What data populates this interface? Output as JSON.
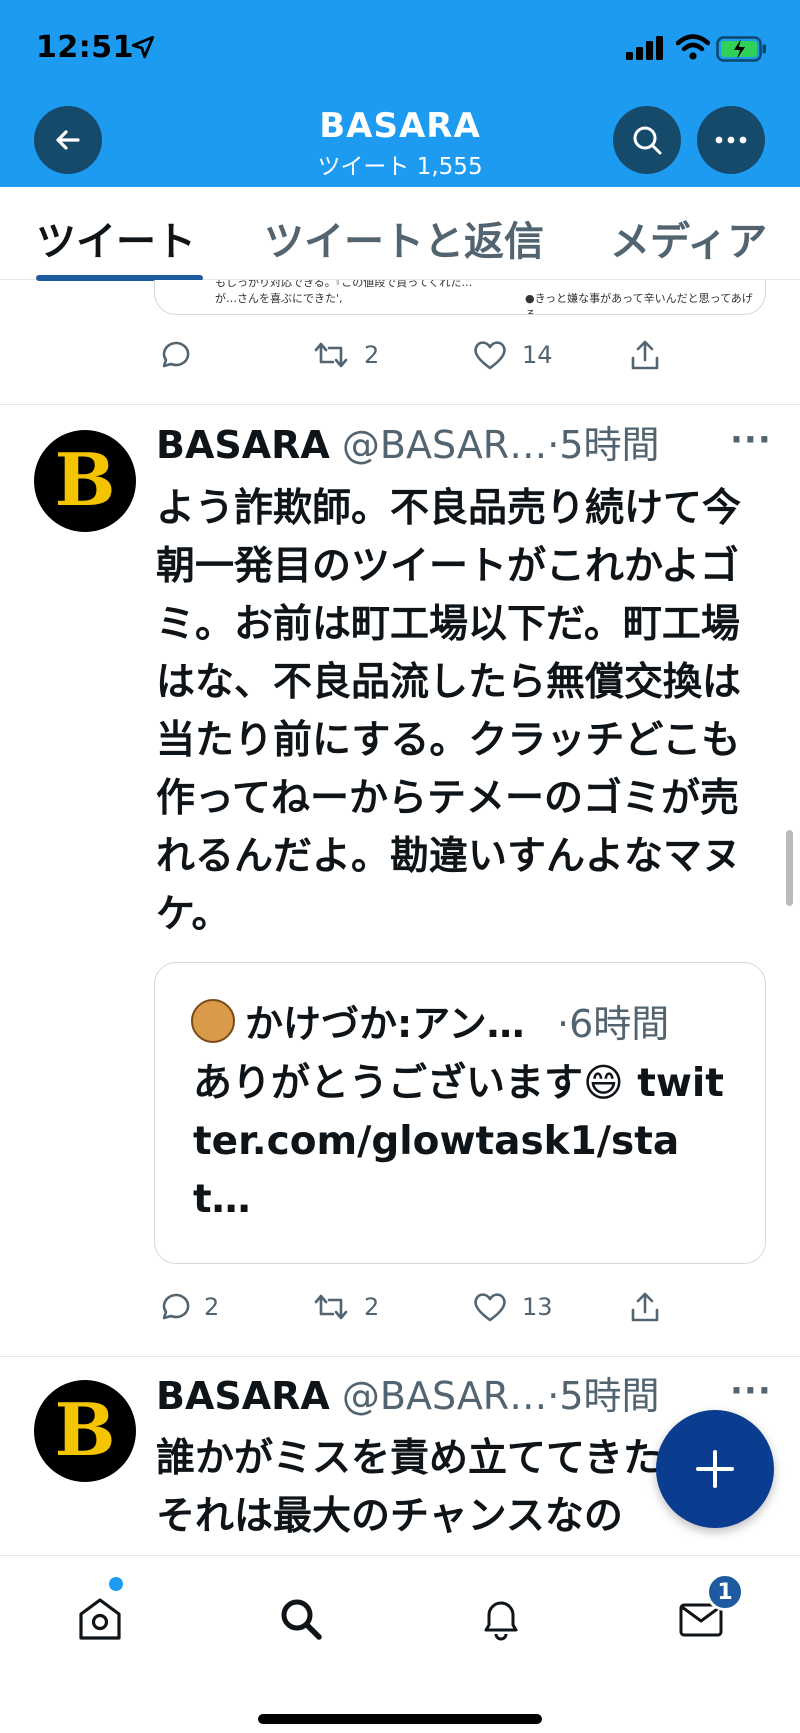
{
  "status_bar": {
    "time": "12:51"
  },
  "header": {
    "title": "BASARA",
    "subtitle": "ツイート 1,555"
  },
  "tabs": [
    {
      "label": "ツイート",
      "active": true
    },
    {
      "label": "ツイートと返信",
      "active": false
    },
    {
      "label": "メディア",
      "active": false
    }
  ],
  "partial_tweet": {
    "card_left_text": "自信を感じてもらいたいし、売った後に何かあってもしっかり対応できる。『この値段で買ってくれた…が…さんを喜ぶにできた',",
    "card_right_text": "●きっと嫌な事があって辛いんだと思ってあげる",
    "reply_count": "",
    "retweet_count": "2",
    "like_count": "14"
  },
  "tweets": [
    {
      "avatar_letter": "B",
      "name": "BASARA",
      "handle": "@BASAR…",
      "dot": "·",
      "time": "5時間",
      "more": "···",
      "body": "よう詐欺師。不良品売り続けて今朝一発目のツイートがこれかよゴミ。お前は町工場以下だ。町工場はな、不良品流したら無償交換は当たり前にする。クラッチどこも作ってねーからテメーのゴミが売れるんだよ。勘違いすんよなマヌケ。",
      "quote": {
        "name": "かけづか:アン…",
        "time": "·6時間",
        "body": "ありがとうございます😄 twitter.com/glowtask1/stat…"
      },
      "reply_count": "2",
      "retweet_count": "2",
      "like_count": "13"
    },
    {
      "avatar_letter": "B",
      "name": "BASARA",
      "handle": "@BASAR…",
      "dot": "·",
      "time": "5時間",
      "more": "···",
      "body": "誰かがミスを責め立ててきた時、それは最大のチャンスなの"
    }
  ],
  "nav": {
    "mail_badge": "1"
  },
  "colors": {
    "header_bg": "#1d9bf0",
    "accent": "#1d5aa0",
    "fab": "#0a3d8f"
  }
}
